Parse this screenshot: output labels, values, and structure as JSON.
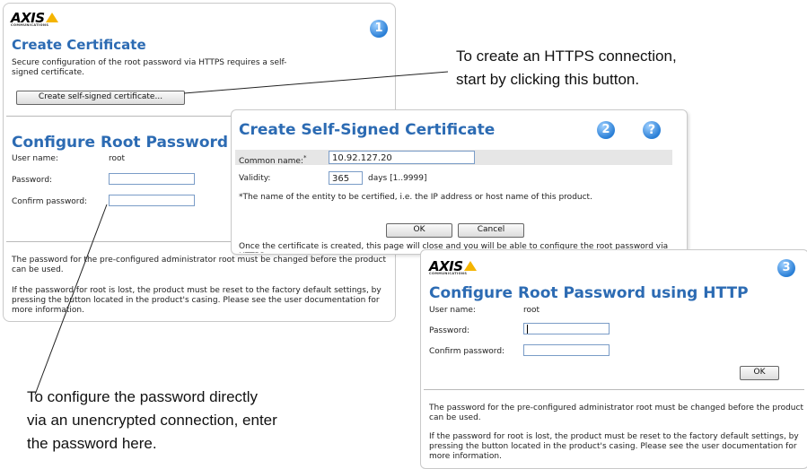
{
  "panel1": {
    "logo": "AXIS",
    "logo_sub": "COMMUNICATIONS",
    "badge": "1",
    "title": "Create Certificate",
    "desc": "Secure configuration of the root password via HTTPS requires a self-signed certificate.",
    "create_button": "Create self-signed certificate...",
    "section_title": "Configure Root Password",
    "username_label": "User name:",
    "username_value": "root",
    "password_label": "Password:",
    "confirm_label": "Confirm password:",
    "note1": "The password for the pre-configured administrator root must be changed before the product can be used.",
    "note2": "If the password for root is lost, the product must be reset to the factory default settings, by pressing the button located in the product's casing. Please see the user documentation for more information."
  },
  "panel2": {
    "title": "Create Self-Signed Certificate",
    "badge": "2",
    "help": "?",
    "common_name_label": "Common name:",
    "common_name_required": "*",
    "common_name_value": "10.92.127.20",
    "validity_label": "Validity:",
    "validity_value": "365",
    "validity_unit": "days [1..9999]",
    "footnote": "*The name of the entity to be certified, i.e. the IP address or host name of this product.",
    "ok_button": "OK",
    "cancel_button": "Cancel",
    "info": "Once the certificate is created, this page will close and you will be able to configure the root password via HTTPS."
  },
  "panel3": {
    "logo": "AXIS",
    "logo_sub": "COMMUNICATIONS",
    "badge": "3",
    "title": "Configure Root Password using HTTP",
    "username_label": "User name:",
    "username_value": "root",
    "password_label": "Password:",
    "confirm_label": "Confirm password:",
    "ok_button": "OK",
    "note1": "The password for the pre-configured administrator root must be changed before the product can be used.",
    "note2": "If the password for root is lost, the product must be reset to the factory default settings, by pressing the button located in the product's casing. Please see the user documentation for more information."
  },
  "annotations": {
    "https_line1": "To create an HTTPS connection,",
    "https_line2": "start by clicking this button.",
    "direct_line1": "To configure the password directly",
    "direct_line2": "via an unencrypted connection, enter",
    "direct_line3": "the password here."
  }
}
